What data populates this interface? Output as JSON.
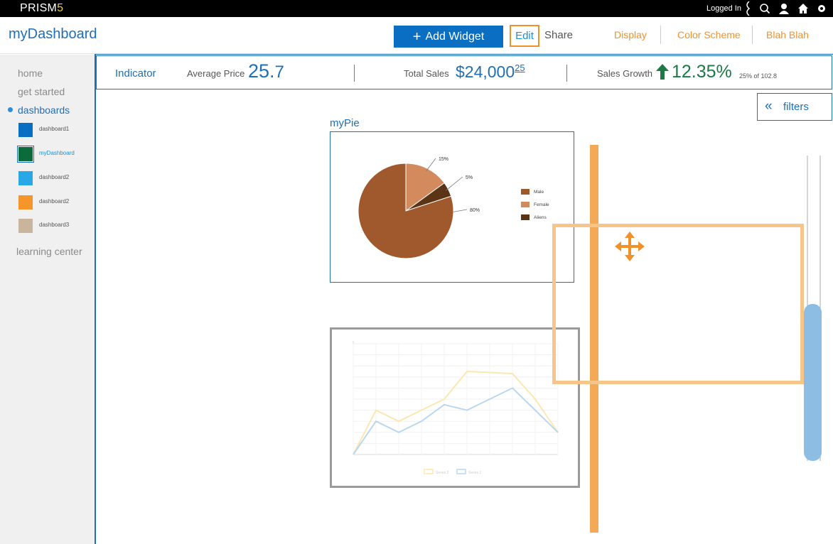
{
  "topbar": {
    "brand_main": "PRISM",
    "brand_accent": "5",
    "logged_in": "Logged In",
    "icons": [
      "search-icon",
      "user-icon",
      "home-icon",
      "settings-icon"
    ]
  },
  "header": {
    "title": "myDashboard",
    "add_widget_label": "Add Widget",
    "edit_label": "Edit",
    "share_label": "Share",
    "links": [
      "Display",
      "Color Scheme",
      "Blah Blah"
    ]
  },
  "sidebar": {
    "items": [
      {
        "label": "home"
      },
      {
        "label": "get started"
      },
      {
        "label": "dashboards"
      },
      {
        "label": "learning center"
      }
    ],
    "dashboards": [
      {
        "label": "dashboard1",
        "color": "#0a6fc2"
      },
      {
        "label": "myDashboard",
        "color": "#0b6b3a"
      },
      {
        "label": "dashboard2",
        "color": "#2aa8e6"
      },
      {
        "label": "dashboard2",
        "color": "#f6962a"
      },
      {
        "label": "dashboard3",
        "color": "#c9b59b"
      }
    ]
  },
  "indicator": {
    "title": "Indicator",
    "avg_price_label": "Average Price",
    "avg_price_int": "25.",
    "avg_price_dec": "7",
    "total_sales_label": "Total Sales",
    "total_sales_value": "$24,000",
    "total_sales_cents": "25",
    "growth_label": "Sales Growth",
    "growth_value": "12.35%",
    "growth_note": "25% of 102.8"
  },
  "filters": {
    "label": "filters"
  },
  "pie_widget": {
    "title": "myPie"
  },
  "chart_data": [
    {
      "type": "pie",
      "title": "myPie",
      "slices": [
        {
          "name": "Male",
          "value": 80,
          "label": "80%",
          "color": "#a0592c"
        },
        {
          "name": "Female",
          "value": 15,
          "label": "15%",
          "color": "#d38a5c"
        },
        {
          "name": "Aliens",
          "value": 5,
          "label": "5%",
          "color": "#5a3414"
        }
      ],
      "legend": "right"
    },
    {
      "type": "line",
      "title": "",
      "x": [
        1,
        2,
        3,
        4,
        5,
        6,
        7,
        8,
        9,
        10
      ],
      "series": [
        {
          "name": "Series 2",
          "values": [
            0,
            4,
            3,
            4,
            5,
            7.5,
            7.4,
            7.3,
            5,
            2
          ],
          "color": "#fbe7b0"
        },
        {
          "name": "Series 1",
          "values": [
            0,
            3,
            2,
            3,
            4.5,
            4,
            5,
            6,
            4,
            2
          ],
          "color": "#bad7ee"
        }
      ],
      "ylim": [
        0,
        10
      ],
      "grid": true,
      "legend": "bottom"
    }
  ]
}
